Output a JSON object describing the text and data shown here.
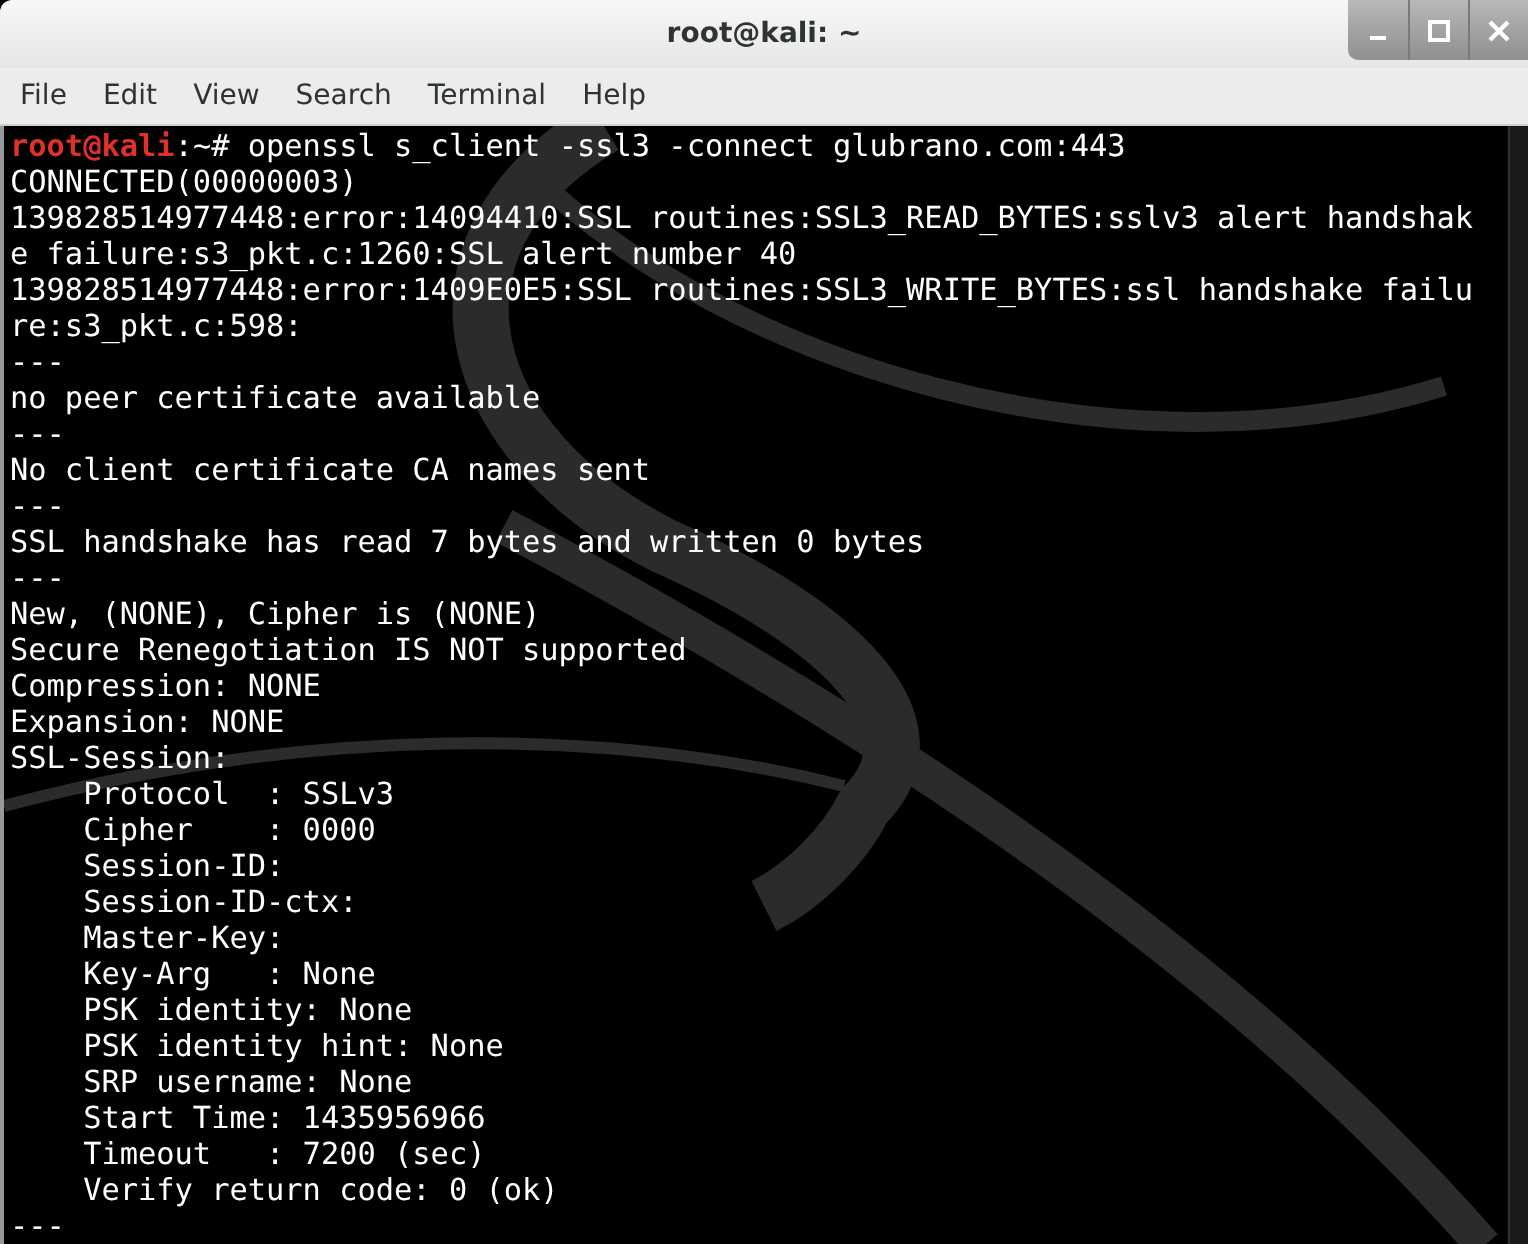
{
  "window": {
    "title": "root@kali: ~"
  },
  "menu": [
    "File",
    "Edit",
    "View",
    "Search",
    "Terminal",
    "Help"
  ],
  "terminal": {
    "lines": [
      {
        "kind": "prompt",
        "user_host": "root@kali",
        "path": ":~# ",
        "command": "openssl s_client -ssl3 -connect glubrano.com:443"
      },
      {
        "kind": "output",
        "text": "CONNECTED(00000003)"
      },
      {
        "kind": "output",
        "text": "139828514977448:error:14094410:SSL routines:SSL3_READ_BYTES:sslv3 alert handshak"
      },
      {
        "kind": "output",
        "text": "e failure:s3_pkt.c:1260:SSL alert number 40"
      },
      {
        "kind": "output",
        "text": "139828514977448:error:1409E0E5:SSL routines:SSL3_WRITE_BYTES:ssl handshake failu"
      },
      {
        "kind": "output",
        "text": "re:s3_pkt.c:598:"
      },
      {
        "kind": "output",
        "text": "---"
      },
      {
        "kind": "output",
        "text": "no peer certificate available"
      },
      {
        "kind": "output",
        "text": "---"
      },
      {
        "kind": "output",
        "text": "No client certificate CA names sent"
      },
      {
        "kind": "output",
        "text": "---"
      },
      {
        "kind": "output",
        "text": "SSL handshake has read 7 bytes and written 0 bytes"
      },
      {
        "kind": "output",
        "text": "---"
      },
      {
        "kind": "output",
        "text": "New, (NONE), Cipher is (NONE)"
      },
      {
        "kind": "output",
        "text": "Secure Renegotiation IS NOT supported"
      },
      {
        "kind": "output",
        "text": "Compression: NONE"
      },
      {
        "kind": "output",
        "text": "Expansion: NONE"
      },
      {
        "kind": "output",
        "text": "SSL-Session:"
      },
      {
        "kind": "output",
        "text": "    Protocol  : SSLv3"
      },
      {
        "kind": "output",
        "text": "    Cipher    : 0000"
      },
      {
        "kind": "output",
        "text": "    Session-ID:"
      },
      {
        "kind": "output",
        "text": "    Session-ID-ctx:"
      },
      {
        "kind": "output",
        "text": "    Master-Key:"
      },
      {
        "kind": "output",
        "text": "    Key-Arg   : None"
      },
      {
        "kind": "output",
        "text": "    PSK identity: None"
      },
      {
        "kind": "output",
        "text": "    PSK identity hint: None"
      },
      {
        "kind": "output",
        "text": "    SRP username: None"
      },
      {
        "kind": "output",
        "text": "    Start Time: 1435956966"
      },
      {
        "kind": "output",
        "text": "    Timeout   : 7200 (sec)"
      },
      {
        "kind": "output",
        "text": "    Verify return code: 0 (ok)"
      },
      {
        "kind": "output",
        "text": "---"
      }
    ]
  }
}
